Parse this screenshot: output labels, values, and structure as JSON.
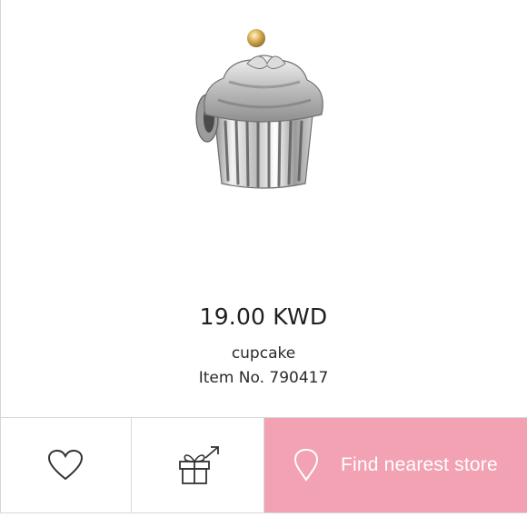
{
  "product": {
    "price": "19.00 KWD",
    "name": "cupcake",
    "item_number": "Item No. 790417",
    "image": "cupcake-charm-image"
  },
  "actions": {
    "wishlist_icon": "heart-icon",
    "gift_icon": "gift-share-icon",
    "store_icon": "location-pin-icon",
    "find_store_label": "Find nearest store"
  },
  "colors": {
    "accent_pink": "#f2a2b3",
    "text": "#222222",
    "divider": "#d9d9d9"
  }
}
